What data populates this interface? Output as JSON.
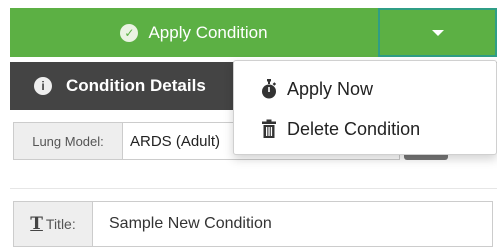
{
  "apply_button": {
    "label": "Apply Condition",
    "icon": "check-circle-icon",
    "color": "#5cb044"
  },
  "details": {
    "header": "Condition Details",
    "header_icon": "info-icon",
    "lung_model": {
      "label": "Lung Model:",
      "value": "ARDS (Adult)"
    },
    "title_field": {
      "label": "Title:",
      "icon": "text-t-icon",
      "value": "Sample New Condition"
    }
  },
  "dropdown_menu": {
    "items": [
      {
        "label": "Apply Now",
        "icon": "stopwatch-icon"
      },
      {
        "label": "Delete Condition",
        "icon": "trash-icon"
      }
    ]
  }
}
